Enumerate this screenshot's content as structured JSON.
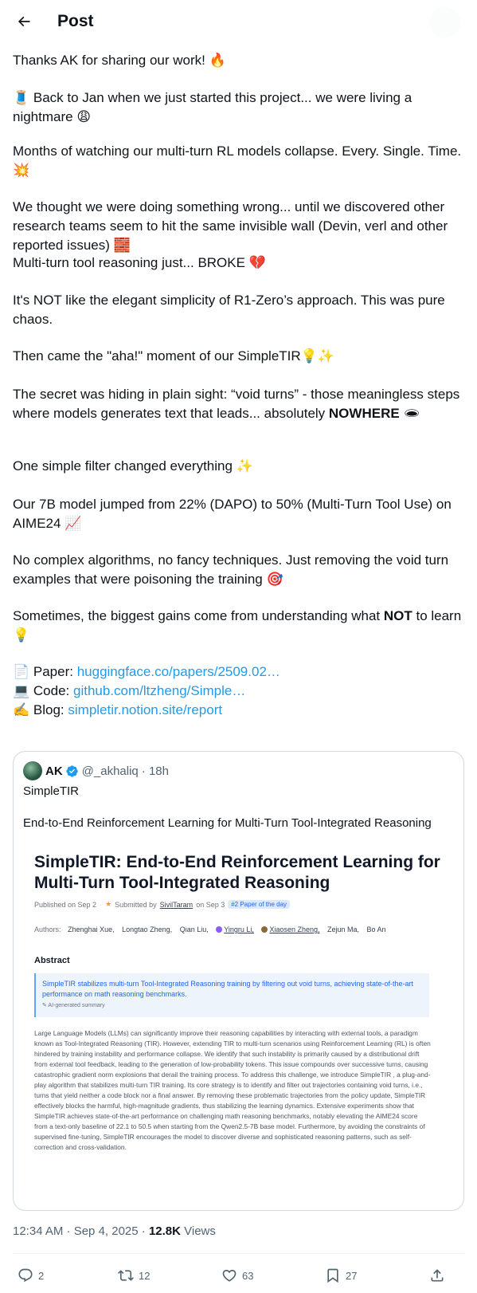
{
  "header": {
    "title": "Post"
  },
  "post": {
    "p1": "Thanks AK for sharing our work! 🔥",
    "p2": "🧵 Back to Jan when we just started this project... we were living a nightmare 😩",
    "p3": "Months of watching our multi-turn RL models collapse. Every. Single. Time. 💥",
    "p4": "We thought we were doing something wrong... until we discovered other research teams seem to hit the same invisible wall (Devin, verl and other reported issues) 🧱",
    "p5": "Multi-turn tool reasoning just... BROKE 💔",
    "p6": "It's NOT like the elegant simplicity of R1-Zero’s approach. This was pure chaos.",
    "p7": "Then came the \"aha!\" moment of our SimpleTIR💡✨",
    "p8_a": "The secret was hiding in plain sight: “void turns” - those meaningless steps where models generates text that leads... absolutely ",
    "p8_b": "NOWHERE",
    "p8_c": " 🕳",
    "p9": "One simple filter changed everything ✨",
    "p10": "Our 7B model jumped from 22% (DAPO) to 50% (Multi-Turn Tool Use) on AIME24 📈",
    "p11": "No complex algorithms, no fancy techniques. Just removing the void turn examples that were poisoning the training 🎯",
    "p12_a": "Sometimes, the biggest gains come from understanding what ",
    "p12_b": "NOT",
    "p12_c": " to learn 💡",
    "paper_label": "📄 Paper: ",
    "paper_link": "huggingface.co/papers/2509.02…",
    "code_label": "💻 Code: ",
    "code_link": "github.com/ltzheng/Simple…",
    "blog_label": "✍️ Blog: ",
    "blog_link": "simpletir.notion.site/report"
  },
  "quote": {
    "name": "AK",
    "handle": "@_akhaliq",
    "time": "· 18h",
    "text1": "SimpleTIR",
    "text2": "End-to-End Reinforcement Learning for Multi-Turn Tool-Integrated Reasoning"
  },
  "paper_img": {
    "title": "SimpleTIR: End-to-End Reinforcement Learning for Multi-Turn Tool-Integrated Reasoning",
    "published": "Published on Sep 2",
    "star": "★",
    "submitted_by": "Submitted by",
    "submitter": "SivilTaram",
    "submitted_on": "on Sep 3",
    "badge": "#2 Paper of the day",
    "authors_label": "Authors:",
    "authors": [
      "Zhenghai Xue,",
      "Longtao Zheng,",
      "Qian Liu,",
      "Yingru Li,",
      "Xiaosen Zheng,",
      "Zejun Ma,",
      "Bo An"
    ],
    "abstract_title": "Abstract",
    "summary": "SimpleTIR stabilizes multi-turn Tool-Integrated Reasoning training by filtering out void turns, achieving state-of-the-art performance on math reasoning benchmarks.",
    "ai_summary": "✎ AI-generated summary",
    "abstract": "Large Language Models (LLMs) can significantly improve their reasoning capabilities by interacting with external tools, a paradigm known as Tool-Integrated Reasoning (TIR). However, extending TIR to multi-turn scenarios using Reinforcement Learning (RL) is often hindered by training instability and performance collapse. We identify that such instability is primarily caused by a distributional drift from external tool feedback, leading to the generation of low-probability tokens. This issue compounds over successive turns, causing catastrophic gradient norm explosions that derail the training process. To address this challenge, we introduce SimpleTIR , a plug-and-play algorithm that stabilizes multi-turn TIR training. Its core strategy is to identify and filter out trajectories containing void turns, i.e., turns that yield neither a code block nor a final answer. By removing these problematic trajectories from the policy update, SimpleTIR effectively blocks the harmful, high-magnitude gradients, thus stabilizing the learning dynamics. Extensive experiments show that SimpleTIR achieves state-of-the-art performance on challenging math reasoning benchmarks, notably elevating the AIME24 score from a text-only baseline of 22.1 to 50.5 when starting from the Qwen2.5-7B base model. Furthermore, by avoiding the constraints of supervised fine-tuning, SimpleTIR encourages the model to discover diverse and sophisticated reasoning patterns, such as self-correction and cross-validation."
  },
  "meta": {
    "time": "12:34 AM · Sep 4, 2025 · ",
    "views_count": "12.8K",
    "views_label": " Views"
  },
  "actions": {
    "replies": "2",
    "reposts": "12",
    "likes": "63",
    "bookmarks": "27"
  },
  "colors": {
    "link": "#1d9bf0",
    "text": "#0f1419",
    "muted": "#536471",
    "border": "#cfd9de"
  }
}
